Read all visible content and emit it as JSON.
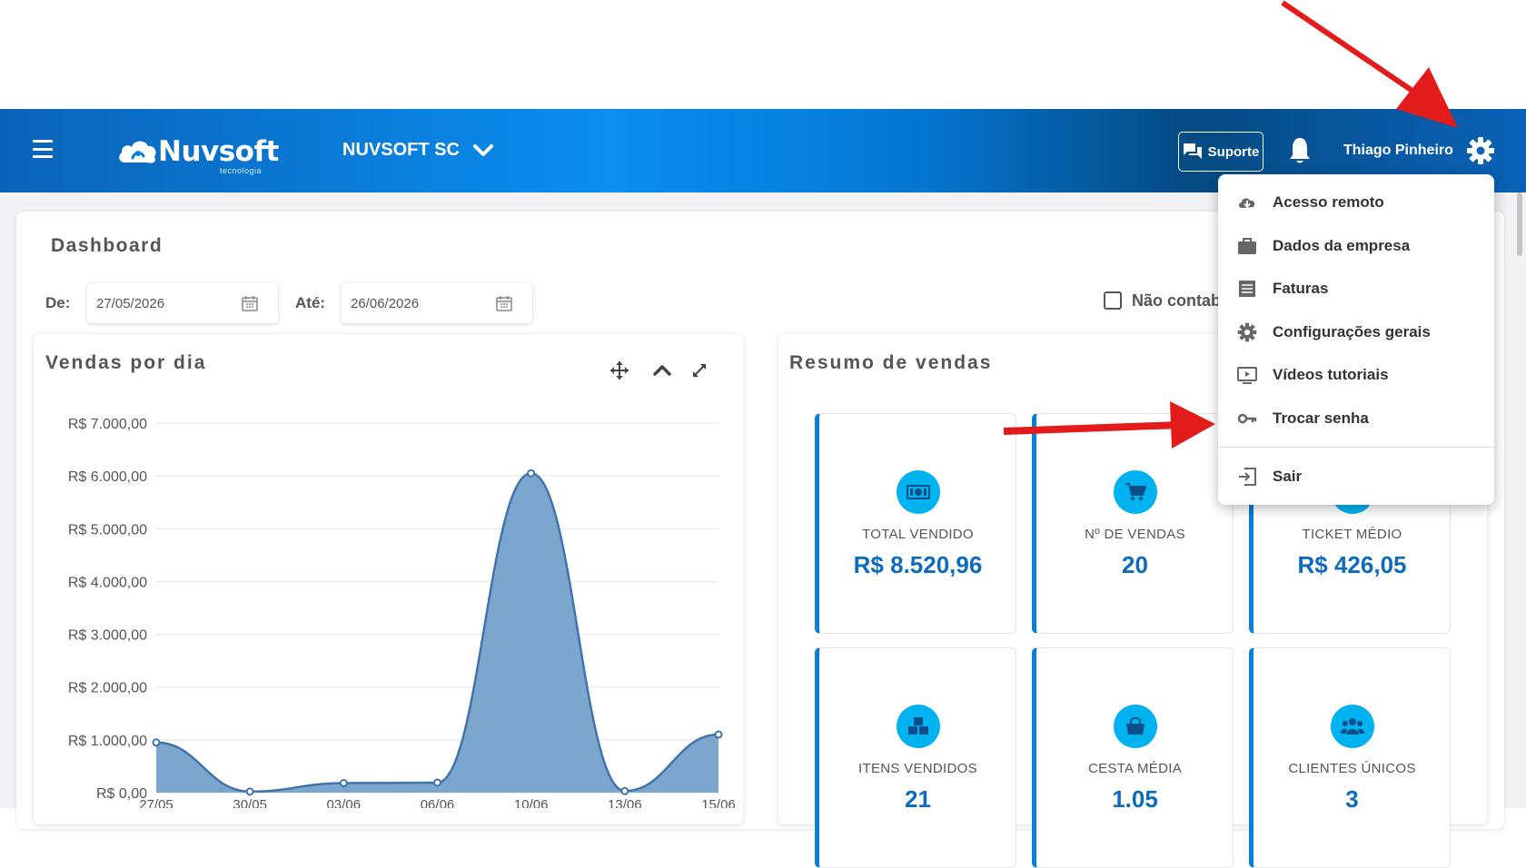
{
  "header": {
    "logo_text": "Nuvsoft",
    "logo_subtext": "tecnologia",
    "company_name": "NUVSOFT SC",
    "support_label": "Suporte",
    "user_name": "Thiago Pinheiro"
  },
  "dashboard": {
    "title": "Dashboard",
    "from_label": "De:",
    "from_value": "27/05/2026",
    "to_label": "Até:",
    "to_value": "26/06/2026",
    "checkbox_label": "Não contab"
  },
  "sales_chart": {
    "title": "Vendas por dia"
  },
  "chart_data": {
    "type": "area",
    "x": [
      "27/05",
      "30/05",
      "03/06",
      "06/06",
      "10/06",
      "13/06",
      "15/06"
    ],
    "y": [
      950,
      20,
      180,
      190,
      6050,
      30,
      1100
    ],
    "y_ticks": [
      "R$ 0,00",
      "R$ 1.000,00",
      "R$ 2.000,00",
      "R$ 3.000,00",
      "R$ 4.000,00",
      "R$ 5.000,00",
      "R$ 6.000,00",
      "R$ 7.000,00"
    ],
    "ylim": [
      0,
      7000
    ],
    "grid": true,
    "color": "#6f9cc9",
    "line_color": "#3f74ad"
  },
  "summary": {
    "title": "Resumo de vendas",
    "cards": [
      {
        "label": "TOTAL VENDIDO",
        "value": "R$ 8.520,96",
        "icon": "money-icon"
      },
      {
        "label": "Nº DE VENDAS",
        "value": "20",
        "icon": "cart-icon"
      },
      {
        "label": "TICKET MÉDIO",
        "value": "R$ 426,05",
        "icon": "ticket-icon"
      },
      {
        "label": "ITENS VENDIDOS",
        "value": "21",
        "icon": "boxes-icon"
      },
      {
        "label": "CESTA MÉDIA",
        "value": "1.05",
        "icon": "basket-icon"
      },
      {
        "label": "CLIENTES ÚNICOS",
        "value": "3",
        "icon": "users-icon"
      }
    ]
  },
  "settings_menu": {
    "items": [
      {
        "label": "Acesso remoto",
        "icon": "cloud-download-icon"
      },
      {
        "label": "Dados da empresa",
        "icon": "briefcase-icon"
      },
      {
        "label": "Faturas",
        "icon": "invoice-icon"
      },
      {
        "label": "Configurações gerais",
        "icon": "gear-icon"
      },
      {
        "label": "Vídeos tutoriais",
        "icon": "video-icon"
      },
      {
        "label": "Trocar senha",
        "icon": "key-icon"
      },
      {
        "label": "Sair",
        "icon": "logout-icon"
      }
    ]
  },
  "colors": {
    "brand_blue": "#0a7fd9",
    "stat_value": "#0c6bbc",
    "icon_circle": "#00b2f0",
    "annotation_arrow": "#e31b1b"
  }
}
